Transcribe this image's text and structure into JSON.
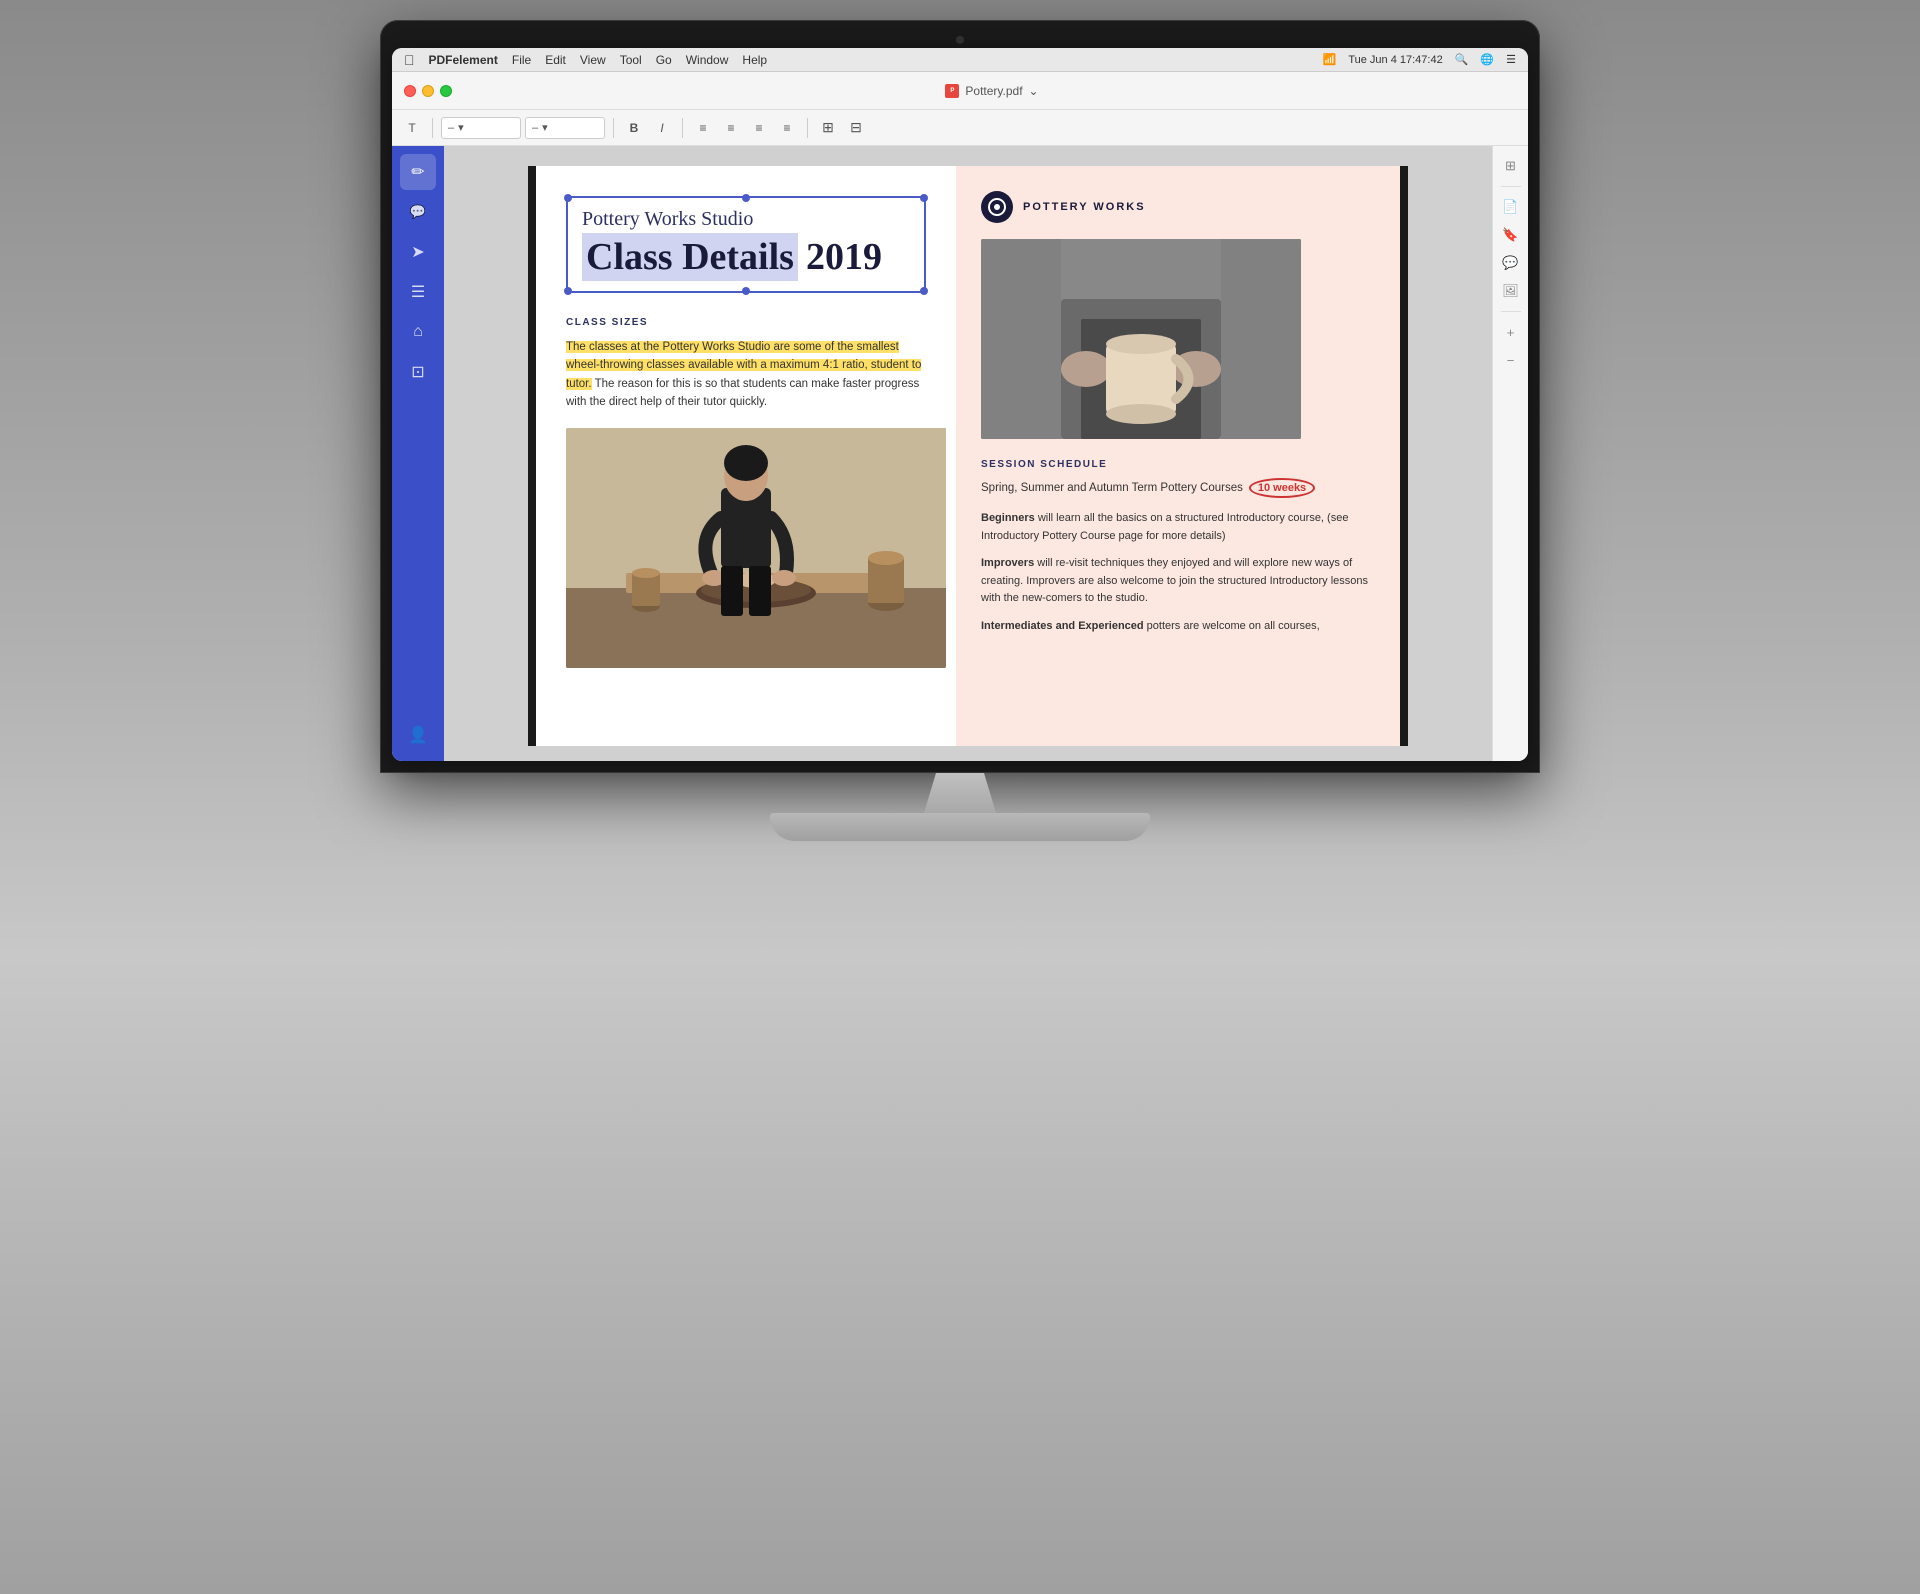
{
  "system": {
    "apple_logo": "",
    "app_name": "PDFelement",
    "menu_items": [
      "File",
      "Edit",
      "View",
      "Tool",
      "Go",
      "Window",
      "Help"
    ],
    "status_bar": {
      "date": "Tue Jun 4",
      "time": "17:47:42"
    },
    "window_title": "Pottery.pdf",
    "window_title_chevron": "⌄"
  },
  "toolbar": {
    "text_tool": "T",
    "font_size_placeholder": "–",
    "dropdowns": [
      "–",
      "–"
    ],
    "bold_label": "B",
    "italic_label": "I",
    "align_options": [
      "≡",
      "≡",
      "≡",
      "≡"
    ]
  },
  "left_sidebar": {
    "icons": [
      {
        "name": "pencil-icon",
        "symbol": "✏",
        "active": true
      },
      {
        "name": "comment-icon",
        "symbol": "💬",
        "active": false
      },
      {
        "name": "send-icon",
        "symbol": "➤",
        "active": false
      },
      {
        "name": "layers-icon",
        "symbol": "⊞",
        "active": false
      },
      {
        "name": "bookmark-icon",
        "symbol": "⌂",
        "active": false
      },
      {
        "name": "page-icon",
        "symbol": "⊡",
        "active": false
      },
      {
        "name": "user-icon",
        "symbol": "👤",
        "active": false
      }
    ]
  },
  "pdf": {
    "left_column": {
      "title_subtitle": "Pottery Works Studio",
      "title_main": "Class Details",
      "title_year": "2019",
      "section_heading": "CLASS SIZES",
      "body_highlighted": "The classes at the Pottery Works Studio are some of the smallest wheel-throwing classes available with a maximum 4:1 ratio, student to tutor.",
      "body_normal": " The reason for this is so that students can make faster progress with the direct help of their tutor quickly."
    },
    "right_column": {
      "logo_text": "POTTERY WORKS",
      "session_heading": "SESSION SCHEDULE",
      "session_line": "Spring, Summer and Autumn Term Pottery Courses",
      "ten_weeks": "10 weeks",
      "beginners_label": "Beginners",
      "beginners_text": " will learn all the basics on a structured Introductory course, (see Introductory Pottery Course page for more details)",
      "improvers_label": "Improvers",
      "improvers_text": " will re-visit techniques they enjoyed and will explore new ways of creating. Improvers are also welcome to join the structured Introductory lessons with the new-comers to the studio.",
      "intermediates_label": "Intermediates and Experienced",
      "intermediates_text": " potters are welcome on all courses,"
    }
  },
  "right_sidebar": {
    "icons": [
      {
        "name": "grid-icon",
        "symbol": "⊞"
      },
      {
        "name": "note-icon",
        "symbol": "📄"
      },
      {
        "name": "bookmark-doc-icon",
        "symbol": "🔖"
      },
      {
        "name": "comment-doc-icon",
        "symbol": "💬"
      },
      {
        "name": "image-icon",
        "symbol": "🖼"
      },
      {
        "name": "add-icon",
        "symbol": "+"
      },
      {
        "name": "minus-icon",
        "symbol": "−"
      }
    ]
  }
}
